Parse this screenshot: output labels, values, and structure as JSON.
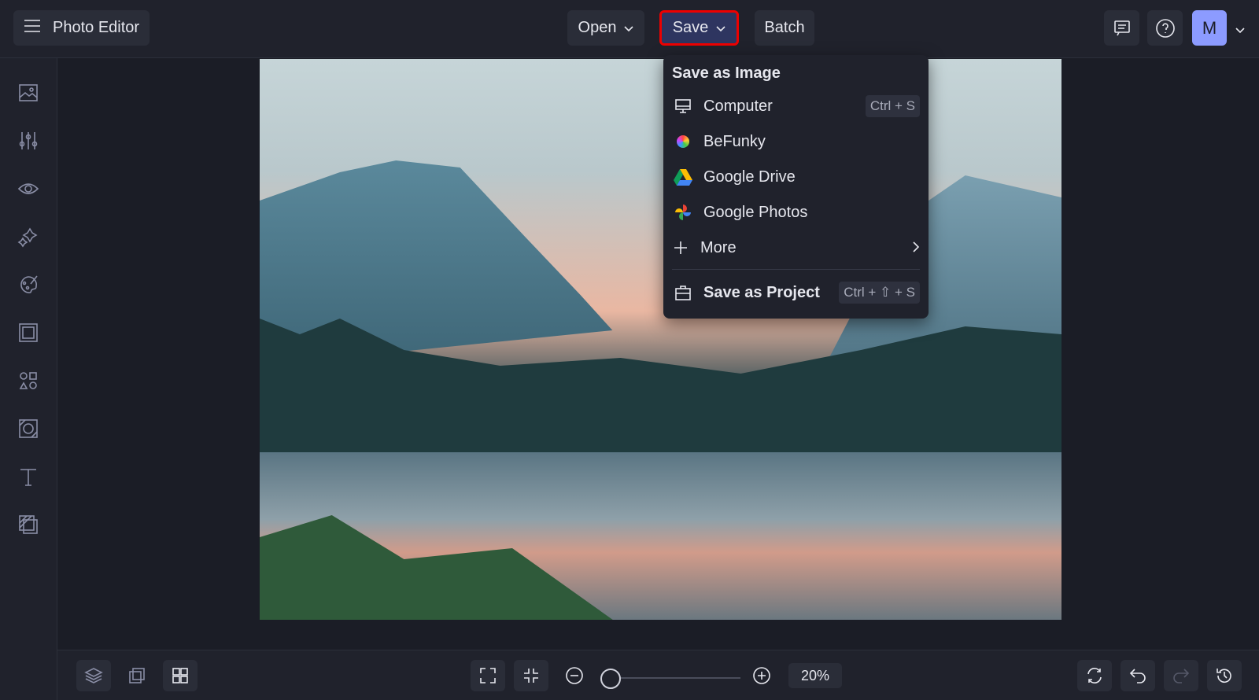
{
  "header": {
    "app_title": "Photo Editor",
    "open_label": "Open",
    "save_label": "Save",
    "batch_label": "Batch",
    "avatar_initial": "M"
  },
  "save_menu": {
    "heading": "Save as Image",
    "items": [
      {
        "label": "Computer",
        "shortcut": "Ctrl + S",
        "icon": "monitor-icon"
      },
      {
        "label": "BeFunky",
        "icon": "befunky-icon"
      },
      {
        "label": "Google Drive",
        "icon": "google-drive-icon"
      },
      {
        "label": "Google Photos",
        "icon": "google-photos-icon"
      },
      {
        "label": "More",
        "icon": "plus-icon"
      }
    ],
    "project": {
      "label": "Save as Project",
      "shortcut": "Ctrl + ⇧ + S"
    }
  },
  "sidebar": [
    "Image Manager",
    "Edit",
    "Touch Up",
    "Effects",
    "Artsy",
    "Frames",
    "Graphics",
    "Overlays",
    "Text",
    "Textures"
  ],
  "bottom": {
    "zoom": "20%",
    "zoom_fraction": 0.05
  },
  "colors": {
    "accent": "#8c9bff",
    "highlight": "#e00000"
  }
}
